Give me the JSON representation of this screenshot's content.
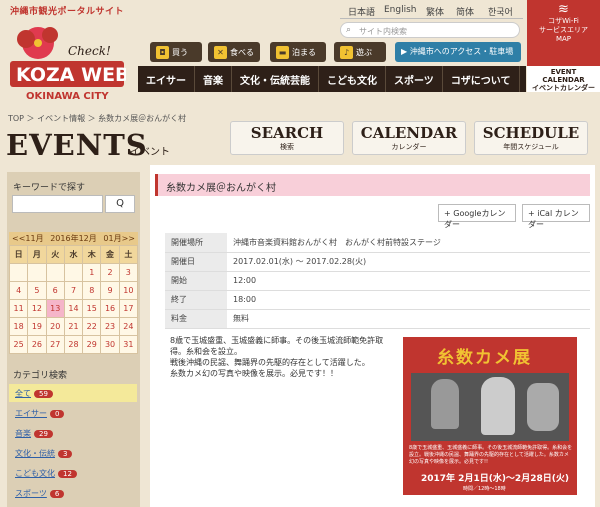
{
  "header": {
    "tagline": "沖縄市観光ポータルサイト",
    "logo_check": "Check!",
    "logo_main": "KOZA WEB",
    "logo_sub": "OKINAWA CITY",
    "languages": [
      "日本語",
      "English",
      "繁体",
      "简体",
      "한국어"
    ],
    "search_placeholder": "サイト内検索",
    "wifi_lines": [
      "コザWi-Fi",
      "サービスエリア",
      "MAP"
    ],
    "quick": [
      {
        "icon": "shopping-bag-icon",
        "label": "買う"
      },
      {
        "icon": "utensils-icon",
        "label": "食べる"
      },
      {
        "icon": "bed-icon",
        "label": "泊まる"
      },
      {
        "icon": "play-icon",
        "label": "遊ぶ"
      }
    ],
    "access_label": "沖縄市へのアクセス・駐車場",
    "nav": [
      "エイサー",
      "音楽",
      "文化・伝統芸能",
      "こども文化",
      "スポーツ",
      "コザについて"
    ],
    "event_calendar": [
      "EVENT",
      "CALENDAR",
      "イベントカレンダー"
    ]
  },
  "breadcrumb": "TOP ＞ イベント情報 ＞ 糸数カメ展＠おんがく村",
  "page_title": "EVENTS",
  "page_title_sub": "イベント",
  "top_tabs": [
    {
      "big": "SEARCH",
      "small": "検索"
    },
    {
      "big": "CALENDAR",
      "small": "カレンダー"
    },
    {
      "big": "SCHEDULE",
      "small": "年間スケジュール"
    }
  ],
  "sidebar": {
    "keyword_label": "キーワードで探す",
    "search_button": "Q",
    "calendar": {
      "prev": "<<11月",
      "current": "2016年12月",
      "next": "01月>>",
      "weekdays": [
        "日",
        "月",
        "火",
        "水",
        "木",
        "金",
        "土"
      ],
      "weeks": [
        [
          "",
          "",
          "",
          "",
          "1",
          "2",
          "3"
        ],
        [
          "4",
          "5",
          "6",
          "7",
          "8",
          "9",
          "10"
        ],
        [
          "11",
          "12",
          "13",
          "14",
          "15",
          "16",
          "17"
        ],
        [
          "18",
          "19",
          "20",
          "21",
          "22",
          "23",
          "24"
        ],
        [
          "25",
          "26",
          "27",
          "28",
          "29",
          "30",
          "31"
        ]
      ],
      "today": "13"
    },
    "category_label": "カテゴリ検索",
    "categories": [
      {
        "name": "全て",
        "count": "59"
      },
      {
        "name": "エイサー",
        "count": "0"
      },
      {
        "name": "音楽",
        "count": "29"
      },
      {
        "name": "文化・伝統",
        "count": "3"
      },
      {
        "name": "こども文化",
        "count": "12"
      },
      {
        "name": "スポーツ",
        "count": "6"
      }
    ]
  },
  "event": {
    "title": "糸数カメ展＠おんがく村",
    "google_btn": "Googleカレンダー",
    "ical_btn": "iCal カレンダー",
    "details": [
      {
        "key": "開催場所",
        "value": "沖縄市音楽資料館おんがく村　おんがく村前特設ステージ"
      },
      {
        "key": "開催日",
        "value": "2017.02.01(水) 〜 2017.02.28(火)"
      },
      {
        "key": "開始",
        "value": "12:00"
      },
      {
        "key": "終了",
        "value": "18:00"
      },
      {
        "key": "料金",
        "value": "無料"
      }
    ],
    "description": [
      "8歳で玉城盛重、玉城盛義に師事。その後玉城流師範免許取",
      "得。糸和会を設立。",
      "戦後沖縄の民謡、舞踊界の先駆的存在として活躍した。",
      "糸数カメ幻の写真や映像を展示。必見です！！"
    ],
    "poster": {
      "title": "糸数カメ展",
      "text": "8歳で玉城盛重、玉城盛義に師事。その後玉城流師範免許取得。糸和会を設立。戦後沖縄の民謡、舞踊界の先駆的存在として活躍した。糸数カメ幻の写真や映像を展示。必見です!!",
      "date": "2017年 2月1日(水)〜2月28日(火)",
      "time": "時間／12時〜18時"
    }
  }
}
